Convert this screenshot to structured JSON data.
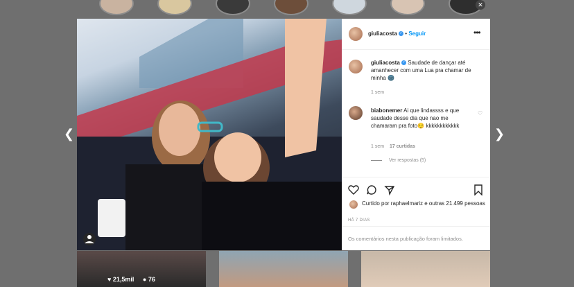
{
  "post": {
    "username": "giuliacosta",
    "follow": "Seguir",
    "caption": "Saudade de dançar até amanhecer com uma Lua pra chamar de minha 🌚",
    "caption_time": "1 sem",
    "comment": {
      "username": "biabonemer",
      "text": "Ai que lindassss e que saudade desse dia que nao me chamaram pra foto😔 kkkkkkkkkkkk",
      "time": "1 sem",
      "likes": "17 curtidas",
      "replies": "Ver respostas (5)"
    },
    "liked_by": "Curtido por raphaelmariz e outras 21.499 pessoas",
    "date": "HÁ 7 DIAS",
    "comments_disabled": "Os comentários nesta publicação foram limitados."
  },
  "grid": {
    "likes": "21,5mil",
    "comments": "76"
  },
  "icons": {
    "more": "more-icon",
    "heart": "heart-icon",
    "comment": "comment-icon",
    "share": "share-icon",
    "save": "bookmark-icon",
    "prev": "chevron-left-icon",
    "next": "chevron-right-icon",
    "user": "user-tag-icon"
  }
}
